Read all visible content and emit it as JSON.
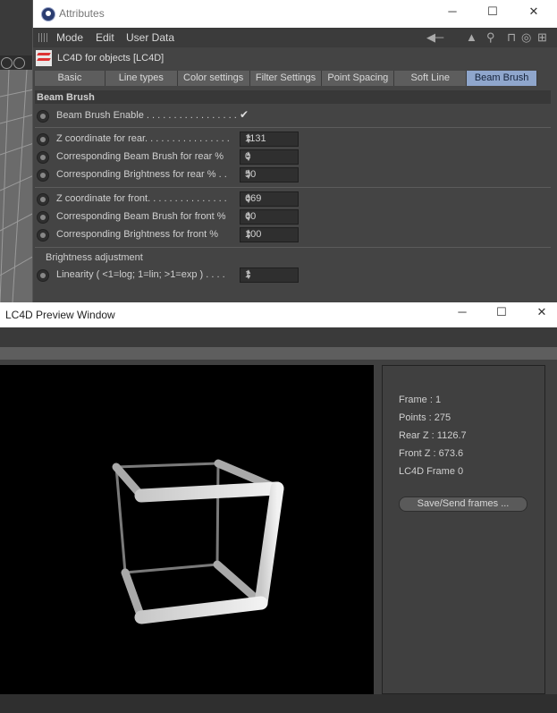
{
  "attributes": {
    "title": "Attributes",
    "menu": [
      "Mode",
      "Edit",
      "User Data"
    ],
    "object_title": "LC4D for objects [LC4D]",
    "tabs": [
      {
        "label": "Basic",
        "active": false
      },
      {
        "label": "Line types",
        "active": false
      },
      {
        "label": "Color settings",
        "active": false
      },
      {
        "label": "Filter Settings",
        "active": false
      },
      {
        "label": "Point Spacing",
        "active": false
      },
      {
        "label": "Soft Line",
        "active": false
      },
      {
        "label": "Beam Brush",
        "active": true
      }
    ],
    "section_title": "Beam Brush",
    "enable_label": "Beam Brush Enable . . . . . . . . . . . . . . . . .",
    "enable_value": "✔",
    "rear": {
      "z_label": "Z coordinate for rear. . . . . . . . . . . . . . . .",
      "z_value": "1131",
      "brush_label": "Corresponding Beam Brush for rear %",
      "brush_value": "0",
      "bright_label": "Corresponding Brightness for rear % . .",
      "bright_value": "50"
    },
    "front": {
      "z_label": "Z coordinate for front. . . . . . . . . . . . . . .",
      "z_value": "669",
      "brush_label": "Corresponding Beam Brush for front %",
      "brush_value": "60",
      "bright_label": "Corresponding Brightness for front %",
      "bright_value": "100"
    },
    "brightness_subhead": "Brightness adjustment",
    "linearity_label": "Linearity ( <1=log; 1=lin; >1=exp ) . . . .",
    "linearity_value": "1"
  },
  "preview": {
    "title": "LC4D Preview Window",
    "info": {
      "frame": "Frame  : 1",
      "points": "Points  : 275",
      "rear_z": "Rear  Z : 1126.7",
      "front_z": "Front Z : 673.6",
      "lc4d_frame": "LC4D Frame 0"
    },
    "save_button": "Save/Send frames ..."
  },
  "window_controls": {
    "minimize": "─",
    "maximize": "☐",
    "close": "✕"
  },
  "colors": {
    "active_tab": "#8fa6cc",
    "panel": "#444444",
    "canvas": "#000000"
  }
}
